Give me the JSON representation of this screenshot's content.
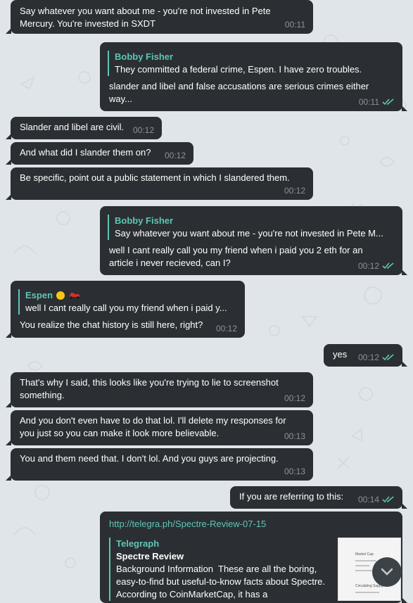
{
  "colors": {
    "bubble": "#2b2f33",
    "accent": "#5dc6b6",
    "time": "#8d9298",
    "background": "#dfe5e9"
  },
  "messages": [
    {
      "text": "Say whatever you want about me - you're not invested in Pete Mercury. You're invested in SXDT",
      "time": "00:11"
    },
    {
      "reply_name": "Bobby Fisher",
      "reply_text": "They committed a federal crime, Espen. I have zero troubles.",
      "text": "slander and libel and false accusations are serious crimes either way...",
      "time": "00:11"
    },
    {
      "text": "Slander and libel are civil.",
      "time": "00:12"
    },
    {
      "text": "And what did I slander them on?",
      "time": "00:12"
    },
    {
      "text": "Be specific, point out a public statement in which I slandered them.",
      "time": "00:12"
    },
    {
      "reply_name": "Bobby Fisher",
      "reply_text": "Say whatever you want about me - you're not invested in Pete M...",
      "text": "well I cant really call you my friend when i paid you 2 eth for an article i never recieved, can I?",
      "time": "00:12"
    },
    {
      "reply_name": "Espen",
      "reply_text": "well I cant really call you my friend when i paid y...",
      "text": "You realize the chat history is still here, right?",
      "time": "00:12"
    },
    {
      "text": "yes",
      "time": "00:12"
    },
    {
      "text": "That's why I said, this looks like you're trying to lie to screenshot something.",
      "time": "00:12"
    },
    {
      "text": "And you don't even have to do that lol. I'll delete my responses for you just so you can make it look more believable.",
      "time": "00:13"
    },
    {
      "text": "You and them need that. I don't lol. And you guys are projecting.",
      "time": "00:13"
    },
    {
      "text": "If you are referring to this:",
      "time": "00:14"
    },
    {
      "link": "http://telegra.ph/Spectre-Review-07-15",
      "site": "Telegraph",
      "title": "Spectre Review",
      "desc": "Background Information  These are all the boring, easy-to-find but useful-to-know facts about Spectre.  According to CoinMarketCap, it has a"
    }
  ],
  "thumbnail": {
    "lines": [
      "Market Cap",
      "Circulating Supply"
    ]
  },
  "scroll_button": {
    "icon": "chevron-down-icon"
  }
}
